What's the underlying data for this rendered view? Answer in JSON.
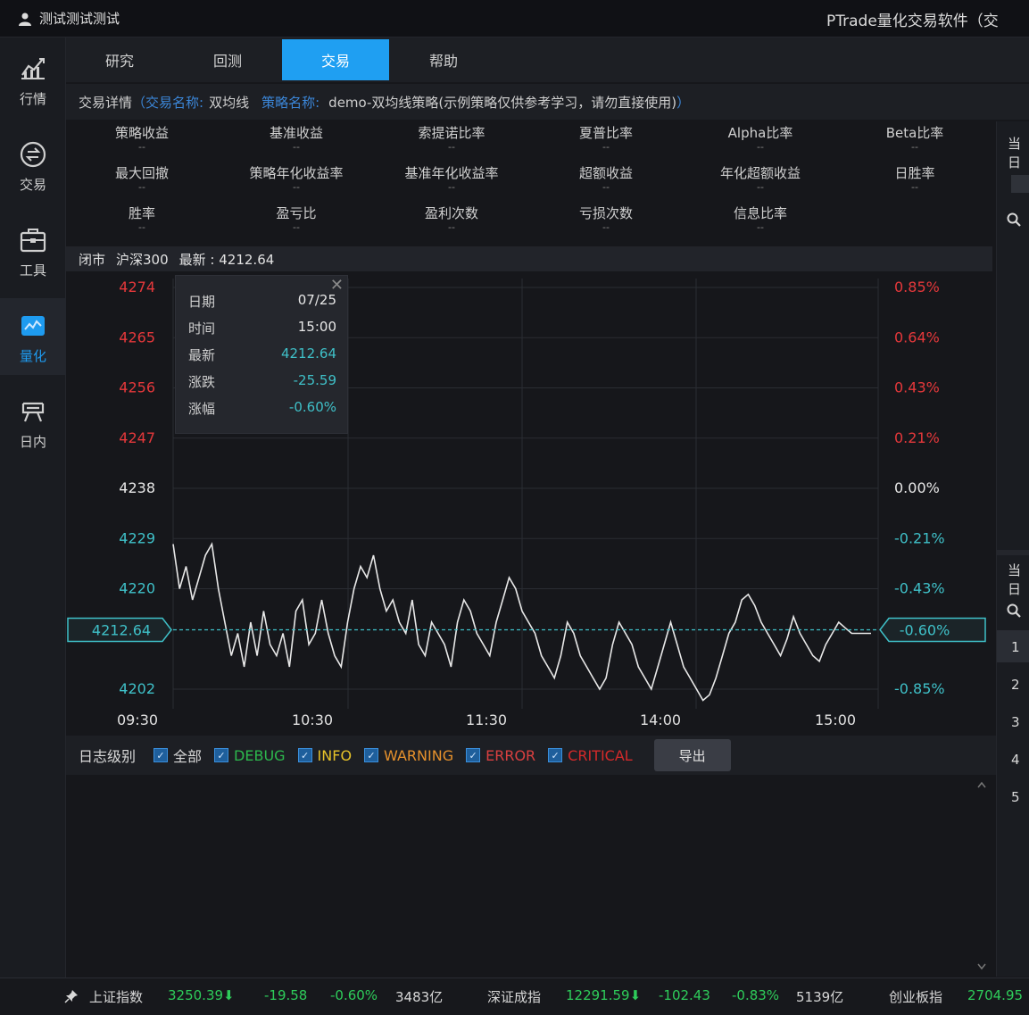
{
  "titlebar": {
    "user": "测试测试测试",
    "app_title": "PTrade量化交易软件（交"
  },
  "sidebar": {
    "items": [
      {
        "label": "行情",
        "icon": "market-chart-icon"
      },
      {
        "label": "交易",
        "icon": "trade-icon"
      },
      {
        "label": "工具",
        "icon": "toolbox-icon"
      },
      {
        "label": "量化",
        "icon": "quant-icon",
        "active": true
      },
      {
        "label": "日内",
        "icon": "intraday-icon"
      }
    ]
  },
  "tabs": [
    {
      "label": "研究"
    },
    {
      "label": "回测"
    },
    {
      "label": "交易",
      "active": true
    },
    {
      "label": "帮助"
    }
  ],
  "infobar": {
    "title": "交易详情",
    "open_paren": "（",
    "trade_label": "交易名称:",
    "trade_name": "双均线",
    "strategy_label": "策略名称:",
    "strategy_name": "demo-双均线策略(示例策略仅供参考学习，请勿直接使用)",
    "close_paren": "）"
  },
  "stats": [
    [
      {
        "name": "策略收益",
        "value": "--"
      },
      {
        "name": "基准收益",
        "value": "--"
      },
      {
        "name": "索提诺比率",
        "value": "--"
      },
      {
        "name": "夏普比率",
        "value": "--"
      },
      {
        "name": "Alpha比率",
        "value": "--"
      },
      {
        "name": "Beta比率",
        "value": "--"
      }
    ],
    [
      {
        "name": "最大回撤",
        "value": "--"
      },
      {
        "name": "策略年化收益率",
        "value": "--"
      },
      {
        "name": "基准年化收益率",
        "value": "--"
      },
      {
        "name": "超额收益",
        "value": "--"
      },
      {
        "name": "年化超额收益",
        "value": "--"
      },
      {
        "name": "日胜率",
        "value": "--"
      }
    ],
    [
      {
        "name": "胜率",
        "value": "--"
      },
      {
        "name": "盈亏比",
        "value": "--"
      },
      {
        "name": "盈利次数",
        "value": "--"
      },
      {
        "name": "亏损次数",
        "value": "--"
      },
      {
        "name": "信息比率",
        "value": "--"
      }
    ]
  ],
  "right_panel": {
    "header_top": "当日",
    "header_mid": "当日",
    "rows": [
      "1",
      "2",
      "3",
      "4",
      "5"
    ]
  },
  "chart_header": {
    "status": "闭市",
    "index_name": "沪深300",
    "latest_label": "最新 : ",
    "latest_value": "4212.64"
  },
  "tooltip": {
    "rows": [
      {
        "k": "日期",
        "v": "07/25",
        "cyan": false
      },
      {
        "k": "时间",
        "v": "15:00",
        "cyan": false
      },
      {
        "k": "最新",
        "v": "4212.64",
        "cyan": true
      },
      {
        "k": "涨跌",
        "v": "-25.59",
        "cyan": true
      },
      {
        "k": "涨幅",
        "v": "-0.60%",
        "cyan": true
      }
    ],
    "close_glyph": "✕"
  },
  "chart_data": {
    "type": "line",
    "series": [
      {
        "name": "沪深300",
        "values": [
          4228,
          4220,
          4224,
          4218,
          4222,
          4226,
          4228,
          4220,
          4214,
          4208,
          4212,
          4206,
          4214,
          4208,
          4216,
          4210,
          4208,
          4212,
          4206,
          4216,
          4218,
          4210,
          4212,
          4218,
          4212,
          4208,
          4206,
          4214,
          4220,
          4224,
          4222,
          4226,
          4220,
          4216,
          4218,
          4214,
          4212,
          4218,
          4210,
          4208,
          4214,
          4212,
          4210,
          4206,
          4214,
          4218,
          4216,
          4212,
          4210,
          4208,
          4214,
          4218,
          4222,
          4220,
          4216,
          4214,
          4212,
          4208,
          4206,
          4204,
          4208,
          4214,
          4212,
          4208,
          4206,
          4204,
          4202,
          4204,
          4210,
          4214,
          4212,
          4210,
          4206,
          4204,
          4202,
          4206,
          4210,
          4214,
          4210,
          4206,
          4204,
          4202,
          4200,
          4201,
          4204,
          4208,
          4212,
          4214,
          4218,
          4219,
          4217,
          4214,
          4212,
          4210,
          4208,
          4211,
          4215,
          4212,
          4210,
          4208,
          4207,
          4210,
          4212,
          4214,
          4213,
          4212,
          4212,
          4212,
          4212
        ]
      }
    ],
    "x_ticks": [
      "09:30",
      "10:30",
      "11:30",
      "14:00",
      "15:00"
    ],
    "y_ticks_left": [
      "4274",
      "4265",
      "4256",
      "4247",
      "4238",
      "4229",
      "4220",
      "4202"
    ],
    "y_ticks_right": [
      "0.85%",
      "0.64%",
      "0.43%",
      "0.21%",
      "0.00%",
      "-0.21%",
      "-0.43%",
      "-0.85%"
    ],
    "baseline": 4238,
    "current": {
      "price": "4212.64",
      "pct": "-0.60%"
    },
    "colors": {
      "up": "#e5383b",
      "down": "#3fc0c8",
      "line": "#e8e8e8",
      "grid": "#2a2d33"
    }
  },
  "logbar": {
    "label": "日志级别",
    "items": [
      {
        "label": "全部",
        "color": "#d8d8d8"
      },
      {
        "label": "DEBUG",
        "color": "#2db84d"
      },
      {
        "label": "INFO",
        "color": "#e6c229"
      },
      {
        "label": "WARNING",
        "color": "#e6912c"
      },
      {
        "label": "ERROR",
        "color": "#d94040"
      },
      {
        "label": "CRITICAL",
        "color": "#d42a2a"
      }
    ],
    "check_glyph": "✓",
    "export_label": "导出"
  },
  "statusbar": {
    "pin_icon": "pin-icon",
    "sh_name": "上证指数",
    "sh_price": "3250.39⬇",
    "sh_change": "-19.58",
    "sh_pct": "-0.60%",
    "sh_volume": "3483亿",
    "sz_name": "深证成指",
    "sz_price": "12291.59⬇",
    "sz_change": "-102.43",
    "sz_pct": "-0.83%",
    "sz_volume": "5139亿",
    "cy_name": "创业板指",
    "cy_price": "2704.95"
  }
}
